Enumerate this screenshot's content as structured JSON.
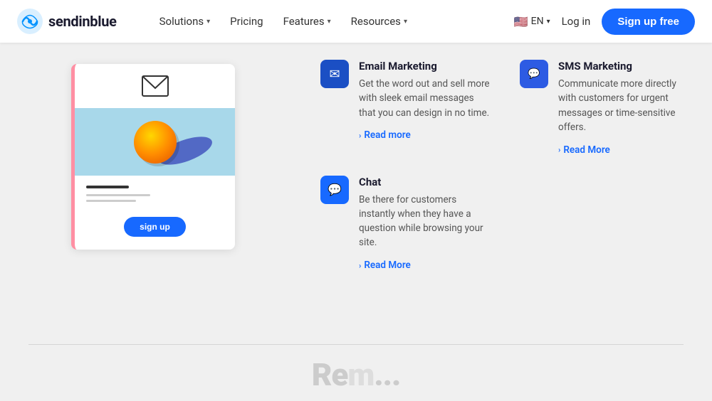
{
  "nav": {
    "logo_text": "sendinblue",
    "links": [
      {
        "label": "Solutions",
        "has_arrow": true
      },
      {
        "label": "Pricing",
        "has_arrow": false
      },
      {
        "label": "Features",
        "has_arrow": true
      },
      {
        "label": "Resources",
        "has_arrow": true
      }
    ],
    "lang": "EN",
    "login_label": "Log in",
    "signup_label": "Sign up free"
  },
  "features": [
    {
      "id": "email-marketing",
      "title": "Email Marketing",
      "description": "Get the word out and sell more with sleek email messages that you can design in no time.",
      "read_more": "Read more",
      "icon_type": "email"
    },
    {
      "id": "sms-marketing",
      "title": "SMS Marketing",
      "description": "Communicate more directly with customers for urgent messages or time-sensitive offers.",
      "read_more": "Read More",
      "icon_type": "sms"
    },
    {
      "id": "chat",
      "title": "Chat",
      "description": "Be there for customers instantly when they have a question while browsing your site.",
      "read_more": "Read More",
      "icon_type": "chat"
    }
  ],
  "preview_card": {
    "signup_label": "sign up"
  },
  "bottom_partial_text": "Rem..."
}
